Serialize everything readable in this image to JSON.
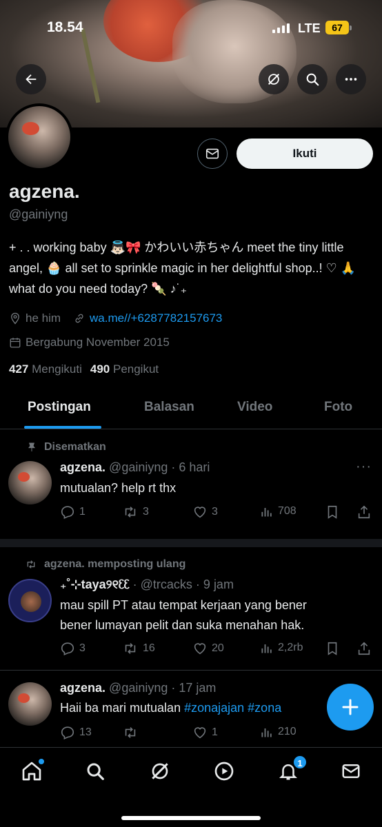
{
  "status_bar": {
    "time": "18.54",
    "network": "LTE",
    "battery": "67"
  },
  "header": {
    "icons": [
      "back-arrow-icon",
      "grok-icon",
      "search-icon",
      "more-icon"
    ]
  },
  "profile": {
    "display_name": "agzena.",
    "handle": "@gainiyng",
    "follow_label": "Ikuti",
    "bio": "+ . . working baby 👼🏻🎀 かわいい赤ちゃん meet the tiny little angel, 🧁 all set to sprinkle magic in her delightful shop..! ♡ 🙏 what do you need today? 🍡 ♪˙₊",
    "pronouns": "he him",
    "link": "wa.me//+6287782157673",
    "joined": "Bergabung November 2015",
    "following_count": "427",
    "following_label": "Mengikuti",
    "followers_count": "490",
    "followers_label": "Pengikut"
  },
  "tabs": [
    {
      "label": "Postingan",
      "active": true
    },
    {
      "label": "Balasan",
      "active": false
    },
    {
      "label": "Video",
      "active": false
    },
    {
      "label": "Foto",
      "active": false
    }
  ],
  "posts": [
    {
      "context": "Disematkan",
      "author": "agzena.",
      "handle_time": "@gainiyng · 6 hari",
      "text_lines": [
        "mutualan? help rt thx"
      ],
      "replies": "1",
      "reposts": "3",
      "likes": "3",
      "views": "708"
    },
    {
      "context": "agzena. memposting ulang",
      "author": "₊˚⊹taya୨୧ᦷᦷ",
      "handle_time": "· @trcacks · 9 jam",
      "text_lines": [
        "mau spill PT atau tempat kerjaan yang bener",
        "bener lumayan pelit dan suka menahan hak."
      ],
      "replies": "3",
      "reposts": "16",
      "likes": "20",
      "views": "2,2rb"
    },
    {
      "author": "agzena.",
      "handle_time": "@gainiyng · 17 jam",
      "text_prefix": "Haii ba mari mutualan ",
      "hashtags": "#zonajajan #zona",
      "replies": "13",
      "reposts": "",
      "likes": "1",
      "views": "210"
    }
  ],
  "bottom_nav": {
    "items": [
      "home-icon",
      "search-icon",
      "grok-icon",
      "video-icon",
      "notifications-icon",
      "messages-icon"
    ],
    "notification_badge": "1"
  },
  "colors": {
    "accent": "#1d9bf0",
    "text": "#e7e9ea",
    "muted": "#71767b",
    "border": "#2f3336"
  }
}
